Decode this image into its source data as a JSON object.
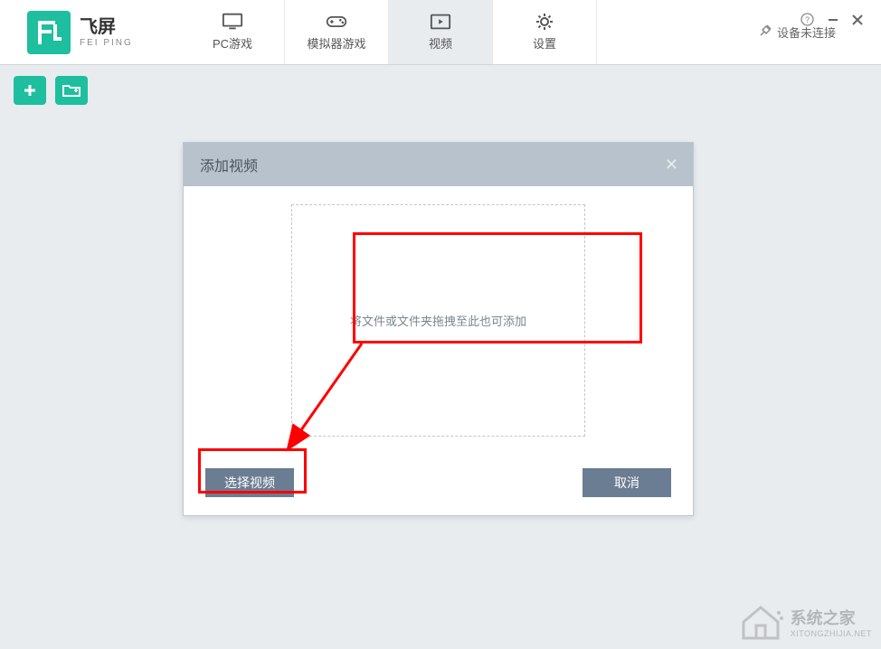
{
  "app": {
    "name_cn": "飞屏",
    "name_en": "FEI PING"
  },
  "tabs": {
    "pc": "PC游戏",
    "emulator": "模拟器游戏",
    "video": "视频",
    "settings": "设置"
  },
  "device": {
    "status": "设备未连接"
  },
  "dialog": {
    "title": "添加视频",
    "drop_hint": "将文件或文件夹拖拽至此也可添加",
    "select_btn": "选择视频",
    "cancel_btn": "取消"
  },
  "watermark": {
    "cn": "系统之家",
    "en": "XITONGZHIJIA.NET"
  }
}
